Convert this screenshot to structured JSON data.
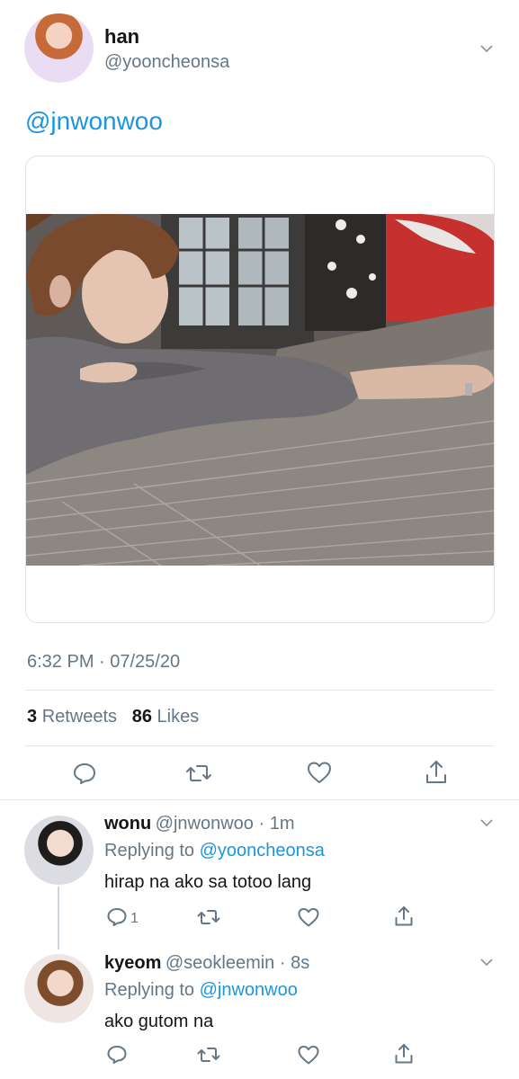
{
  "tweet": {
    "display_name": "han",
    "handle": "@yooncheonsa",
    "body_mention": "@jnwonwoo",
    "timestamp": "6:32 PM · 07/25/20",
    "retweets_count": "3",
    "retweets_label": "Retweets",
    "likes_count": "86",
    "likes_label": "Likes"
  },
  "replies": [
    {
      "display_name": "wonu",
      "handle_time": "@jnwonwoo · 1m",
      "replying_prefix": "Replying to",
      "replying_to": "@yooncheonsa",
      "text": "hirap na ako sa totoo lang",
      "reply_count": "1"
    },
    {
      "display_name": "kyeom",
      "handle_time": "@seokleemin · 8s",
      "replying_prefix": "Replying to",
      "replying_to": "@jnwonwoo",
      "text": "ako gutom na",
      "reply_count": ""
    }
  ],
  "icons": {
    "reply": "reply-icon",
    "retweet": "retweet-icon",
    "like": "heart-icon",
    "share": "share-icon",
    "more": "chevron-down-icon"
  },
  "colors": {
    "link": "#1b95e0",
    "secondary_text": "#657786",
    "primary_text": "#14171a",
    "divider": "#e1e8ed"
  }
}
